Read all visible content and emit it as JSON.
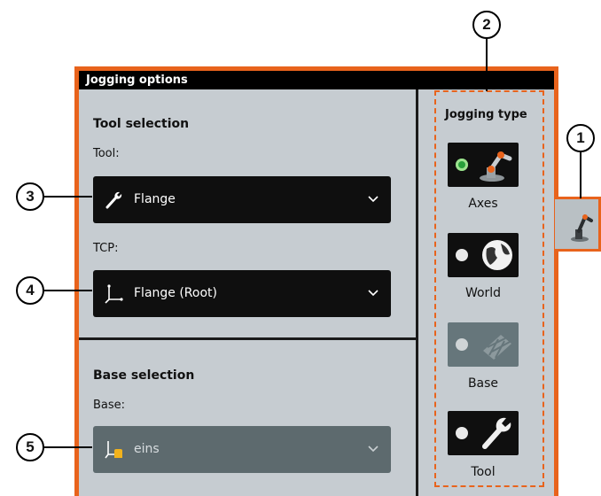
{
  "panel": {
    "title": "Jogging options"
  },
  "tool_selection": {
    "title": "Tool selection",
    "tool": {
      "label": "Tool:",
      "value": "Flange",
      "icon": "wrench-icon"
    },
    "tcp": {
      "label": "TCP:",
      "value": "Flange (Root)",
      "icon": "coordinate-axes-icon"
    }
  },
  "base_selection": {
    "title": "Base selection",
    "base": {
      "label": "Base:",
      "value": "eins",
      "icon": "base-hand-icon",
      "enabled": false
    }
  },
  "jogging_type": {
    "title": "Jogging type",
    "options": [
      {
        "label": "Axes",
        "icon": "robot-arm-icon",
        "selected": true,
        "enabled": true
      },
      {
        "label": "World",
        "icon": "globe-icon",
        "selected": false,
        "enabled": true
      },
      {
        "label": "Base",
        "icon": "grid-icon",
        "selected": false,
        "enabled": false
      },
      {
        "label": "Tool",
        "icon": "wrench-icon",
        "selected": false,
        "enabled": true
      }
    ]
  },
  "side_tab": {
    "icon": "robot-arm-icon"
  },
  "callouts": [
    "1",
    "2",
    "3",
    "4",
    "5"
  ],
  "colors": {
    "accent": "#e8631c",
    "panel_bg": "#c6ccd1",
    "selected_radio": "#28a03a"
  }
}
